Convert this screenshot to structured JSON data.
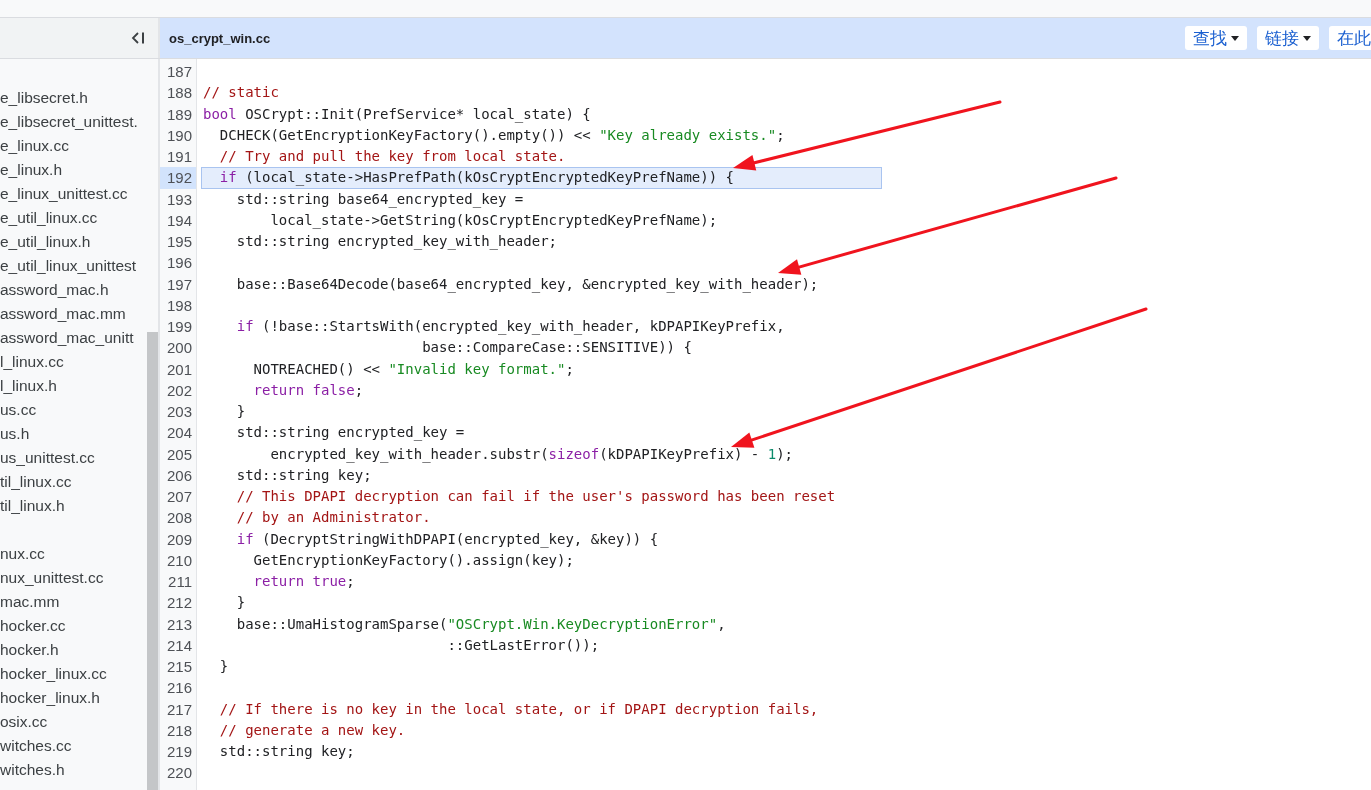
{
  "sidebar": {
    "groups": [
      {
        "items": [
          {
            "name": "e_libsecret.h"
          },
          {
            "name": "e_libsecret_unittest."
          },
          {
            "name": "e_linux.cc"
          },
          {
            "name": "e_linux.h"
          },
          {
            "name": "e_linux_unittest.cc"
          },
          {
            "name": "e_util_linux.cc"
          },
          {
            "name": "e_util_linux.h"
          },
          {
            "name": "e_util_linux_unittest"
          },
          {
            "name": "assword_mac.h"
          },
          {
            "name": "assword_mac.mm"
          },
          {
            "name": "assword_mac_unitt"
          },
          {
            "name": "l_linux.cc"
          },
          {
            "name": "l_linux.h"
          },
          {
            "name": "us.cc"
          },
          {
            "name": "us.h"
          },
          {
            "name": "us_unittest.cc"
          },
          {
            "name": "til_linux.cc"
          },
          {
            "name": "til_linux.h"
          }
        ]
      },
      {
        "items": [
          {
            "name": "nux.cc"
          },
          {
            "name": "nux_unittest.cc"
          },
          {
            "name": "mac.mm"
          },
          {
            "name": "hocker.cc"
          },
          {
            "name": "hocker.h"
          },
          {
            "name": "hocker_linux.cc"
          },
          {
            "name": "hocker_linux.h"
          },
          {
            "name": "osix.cc"
          },
          {
            "name": "witches.cc"
          },
          {
            "name": "witches.h"
          }
        ]
      }
    ]
  },
  "file_header": {
    "title": "os_crypt_win.cc",
    "buttons": [
      {
        "label": "查找",
        "dropdown": true
      },
      {
        "label": "链接",
        "dropdown": true
      },
      {
        "label": "在此",
        "dropdown": false
      }
    ]
  },
  "code": {
    "lines": [
      {
        "number": "187",
        "selected": false
      },
      {
        "number": "188",
        "selected": false,
        "segments": [
          {
            "kind": "comment",
            "text": "// static"
          }
        ]
      },
      {
        "number": "189",
        "selected": false,
        "segments": [
          {
            "kind": "keyword",
            "text": "bool"
          },
          {
            "kind": "plain",
            "text": " OSCrypt::Init(PrefService* local_state) {"
          }
        ]
      },
      {
        "number": "190",
        "selected": false,
        "segments": [
          {
            "kind": "plain",
            "text": "  DCHECK(GetEncryptionKeyFactory().empty()) << "
          },
          {
            "kind": "string",
            "text": "\"Key already exists.\""
          },
          {
            "kind": "plain",
            "text": ";"
          }
        ]
      },
      {
        "number": "191",
        "selected": false,
        "segments": [
          {
            "kind": "comment",
            "text": "  // Try and pull the key from local state."
          }
        ]
      },
      {
        "number": "192",
        "selected": true,
        "segments": [
          {
            "kind": "keyword",
            "text": "  if"
          },
          {
            "kind": "plain",
            "text": " (local_state->HasPrefPath(kOsCryptEncryptedKeyPrefName)) {"
          }
        ]
      },
      {
        "number": "193",
        "selected": false,
        "segments": [
          {
            "kind": "plain",
            "text": "    std::string base64_encrypted_key ="
          }
        ]
      },
      {
        "number": "194",
        "selected": false,
        "segments": [
          {
            "kind": "plain",
            "text": "        local_state->GetString(kOsCryptEncryptedKeyPrefName);"
          }
        ]
      },
      {
        "number": "195",
        "selected": false,
        "segments": [
          {
            "kind": "plain",
            "text": "    std::string encrypted_key_with_header;"
          }
        ]
      },
      {
        "number": "196",
        "selected": false
      },
      {
        "number": "197",
        "selected": false,
        "segments": [
          {
            "kind": "plain",
            "text": "    base::Base64Decode(base64_encrypted_key, &encrypted_key_with_header);"
          }
        ]
      },
      {
        "number": "198",
        "selected": false
      },
      {
        "number": "199",
        "selected": false,
        "segments": [
          {
            "kind": "keyword",
            "text": "    if"
          },
          {
            "kind": "plain",
            "text": " (!base::StartsWith(encrypted_key_with_header, kDPAPIKeyPrefix,"
          }
        ]
      },
      {
        "number": "200",
        "selected": false,
        "segments": [
          {
            "kind": "plain",
            "text": "                          base::CompareCase::SENSITIVE)) {"
          }
        ]
      },
      {
        "number": "201",
        "selected": false,
        "segments": [
          {
            "kind": "plain",
            "text": "      NOTREACHED() << "
          },
          {
            "kind": "string",
            "text": "\"Invalid key format.\""
          },
          {
            "kind": "plain",
            "text": ";"
          }
        ]
      },
      {
        "number": "202",
        "selected": false,
        "segments": [
          {
            "kind": "keyword",
            "text": "      return"
          },
          {
            "kind": "keyword",
            "text": " false"
          },
          {
            "kind": "plain",
            "text": ";"
          }
        ]
      },
      {
        "number": "203",
        "selected": false,
        "segments": [
          {
            "kind": "plain",
            "text": "    }"
          }
        ]
      },
      {
        "number": "204",
        "selected": false,
        "segments": [
          {
            "kind": "plain",
            "text": "    std::string encrypted_key ="
          }
        ]
      },
      {
        "number": "205",
        "selected": false,
        "segments": [
          {
            "kind": "plain",
            "text": "        encrypted_key_with_header.substr("
          },
          {
            "kind": "keyword",
            "text": "sizeof"
          },
          {
            "kind": "plain",
            "text": "(kDPAPIKeyPrefix) - "
          },
          {
            "kind": "number",
            "text": "1"
          },
          {
            "kind": "plain",
            "text": ");"
          }
        ]
      },
      {
        "number": "206",
        "selected": false,
        "segments": [
          {
            "kind": "plain",
            "text": "    std::string key;"
          }
        ]
      },
      {
        "number": "207",
        "selected": false,
        "segments": [
          {
            "kind": "comment",
            "text": "    // This DPAPI decryption can fail if the user's password has been reset"
          }
        ]
      },
      {
        "number": "208",
        "selected": false,
        "segments": [
          {
            "kind": "comment",
            "text": "    // by an Administrator."
          }
        ]
      },
      {
        "number": "209",
        "selected": false,
        "segments": [
          {
            "kind": "keyword",
            "text": "    if"
          },
          {
            "kind": "plain",
            "text": " (DecryptStringWithDPAPI(encrypted_key, &key)) {"
          }
        ]
      },
      {
        "number": "210",
        "selected": false,
        "segments": [
          {
            "kind": "plain",
            "text": "      GetEncryptionKeyFactory().assign(key);"
          }
        ]
      },
      {
        "number": "211",
        "selected": false,
        "segments": [
          {
            "kind": "keyword",
            "text": "      return"
          },
          {
            "kind": "keyword",
            "text": " true"
          },
          {
            "kind": "plain",
            "text": ";"
          }
        ]
      },
      {
        "number": "212",
        "selected": false,
        "segments": [
          {
            "kind": "plain",
            "text": "    }"
          }
        ]
      },
      {
        "number": "213",
        "selected": false,
        "segments": [
          {
            "kind": "plain",
            "text": "    base::UmaHistogramSparse("
          },
          {
            "kind": "string",
            "text": "\"OSCrypt.Win.KeyDecryptionError\""
          },
          {
            "kind": "plain",
            "text": ","
          }
        ]
      },
      {
        "number": "214",
        "selected": false,
        "segments": [
          {
            "kind": "plain",
            "text": "                             ::GetLastError());"
          }
        ]
      },
      {
        "number": "215",
        "selected": false,
        "segments": [
          {
            "kind": "plain",
            "text": "  }"
          }
        ]
      },
      {
        "number": "216",
        "selected": false
      },
      {
        "number": "217",
        "selected": false,
        "segments": [
          {
            "kind": "comment",
            "text": "  // If there is no key in the local state, or if DPAPI decryption fails,"
          }
        ]
      },
      {
        "number": "218",
        "selected": false,
        "segments": [
          {
            "kind": "comment",
            "text": "  // generate a new key."
          }
        ]
      },
      {
        "number": "219",
        "selected": false,
        "segments": [
          {
            "kind": "plain",
            "text": "  std::string key;"
          }
        ]
      },
      {
        "number": "220",
        "selected": false
      }
    ]
  },
  "annotations": [
    {
      "kind": "arrow"
    },
    {
      "kind": "arrow"
    },
    {
      "kind": "arrow"
    }
  ]
}
